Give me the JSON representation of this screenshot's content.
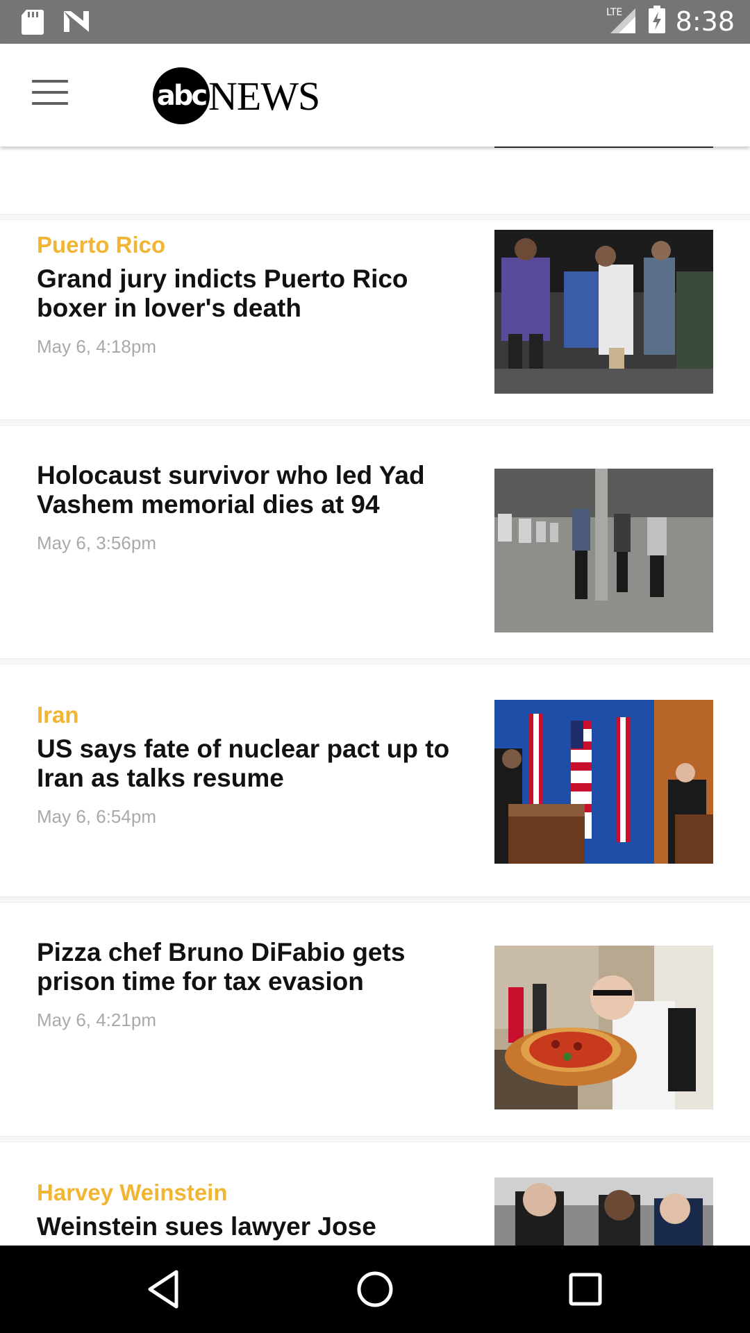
{
  "status_bar": {
    "time": "8:38",
    "network": "LTE",
    "icons": [
      "sd-card-icon",
      "n-notification-icon",
      "signal-icon",
      "battery-charging-icon"
    ]
  },
  "header": {
    "logo_circle_text": "abc",
    "logo_text": "NEWS",
    "menu_icon": "hamburger-menu-icon"
  },
  "stories": [
    {
      "category": "Puerto Rico",
      "headline": "Grand jury indicts Puerto Rico boxer in lover's death",
      "timestamp": "May 6, 4:18pm"
    },
    {
      "category": "",
      "headline": "Holocaust survivor who led Yad Vashem memorial dies at 94",
      "timestamp": "May 6, 3:56pm"
    },
    {
      "category": "Iran",
      "headline": "US says fate of nuclear pact up to Iran as talks resume",
      "timestamp": "May 6, 6:54pm"
    },
    {
      "category": "",
      "headline": "Pizza chef Bruno DiFabio gets prison time for tax evasion",
      "timestamp": "May 6, 4:21pm"
    },
    {
      "category": "Harvey Weinstein",
      "headline": "Weinstein sues lawyer Jose",
      "timestamp": ""
    }
  ],
  "nav_bar": {
    "icons": [
      "back-icon",
      "home-icon",
      "recents-icon"
    ]
  },
  "colors": {
    "category": "#f2b533",
    "status_bar": "#757575",
    "nav_bar": "#000000",
    "timestamp": "#a9a9a9"
  }
}
